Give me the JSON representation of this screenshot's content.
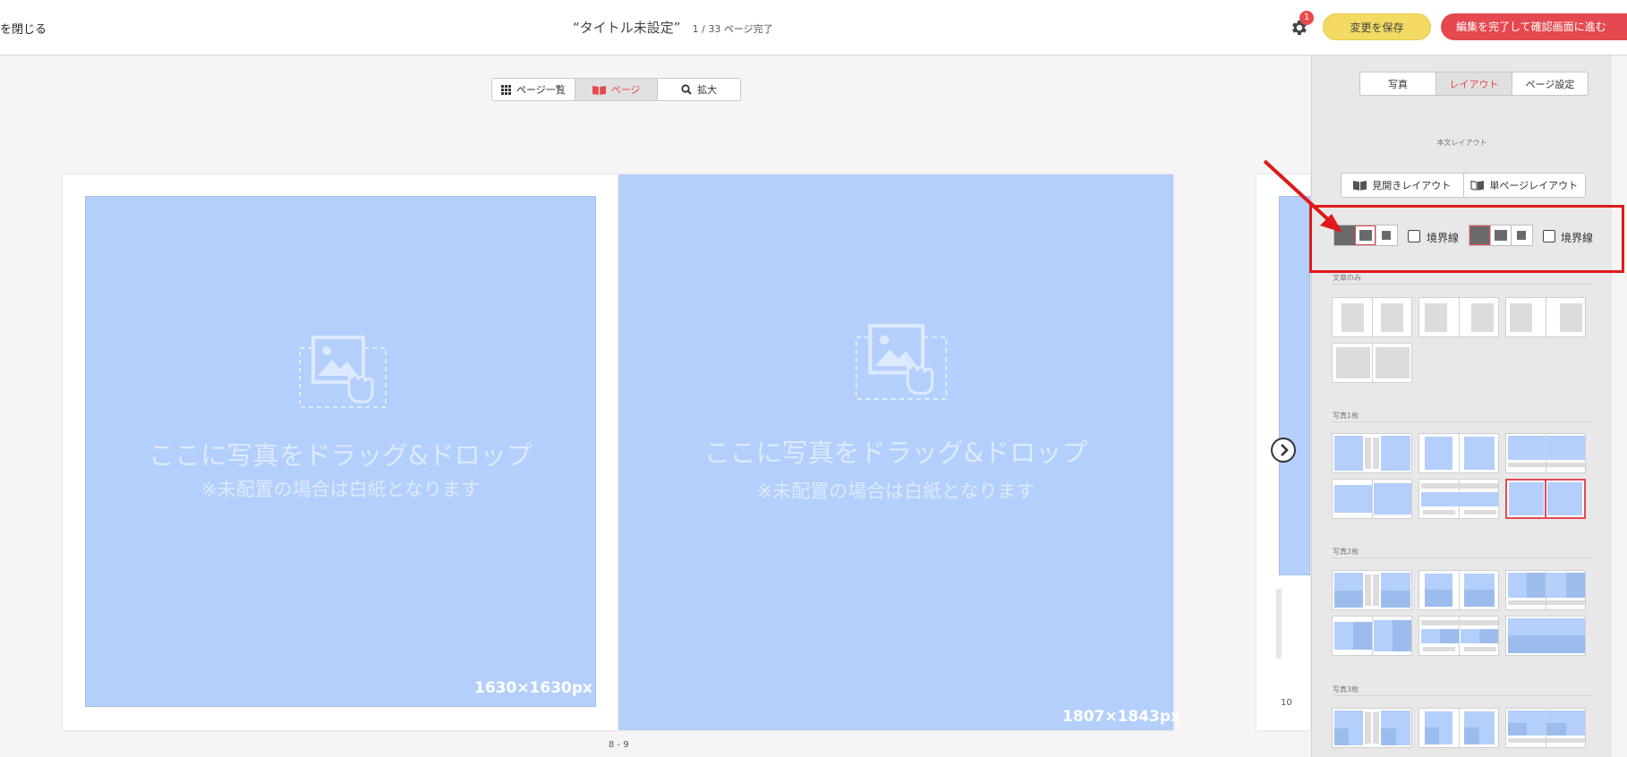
{
  "header": {
    "close_label": "を閉じる",
    "title": "“タイトル未設定”",
    "progress": "1 / 33 ページ完了",
    "notification_count": "1",
    "save_label": "変更を保存",
    "finish_label": "編集を完了して確認画面に進む"
  },
  "view_toggle": {
    "items": [
      {
        "label": "ページ一覧",
        "icon": "grid-icon"
      },
      {
        "label": "ページ",
        "icon": "book-icon",
        "active": true
      },
      {
        "label": "拡大",
        "icon": "search-icon"
      }
    ]
  },
  "canvas": {
    "left_page": {
      "drop_text": "ここに写真をドラッグ&ドロップ",
      "drop_note": "※未配置の場合は白紙となります",
      "size": "1630×1630px"
    },
    "right_page": {
      "drop_text": "ここに写真をドラッグ&ドロップ",
      "drop_note": "※未配置の場合は白紙となります",
      "size": "1807×1843px"
    },
    "spread_number": "8 - 9",
    "next_page_number": "10"
  },
  "panel": {
    "tabs": [
      {
        "label": "写真"
      },
      {
        "label": "レイアウト",
        "active": true
      },
      {
        "label": "ページ設定"
      }
    ],
    "caption": "本文レイアウト",
    "layout_types": [
      {
        "label": "見開きレイアウト",
        "icon": "open-book-icon"
      },
      {
        "label": "単ページレイアウト",
        "icon": "single-page-icon"
      }
    ],
    "border_options": [
      {
        "label": "境界線",
        "checked": false
      },
      {
        "label": "境界線",
        "checked": false
      }
    ],
    "sections": [
      {
        "label": "文章のみ"
      },
      {
        "label": "写真1枚"
      },
      {
        "label": "写真2枚"
      },
      {
        "label": "写真3枚"
      }
    ]
  },
  "colors": {
    "accent_red": "#e5494f",
    "save_yellow": "#f2da63",
    "photo_blue": "#b4cffc",
    "annotation_red": "#e01a1a"
  }
}
